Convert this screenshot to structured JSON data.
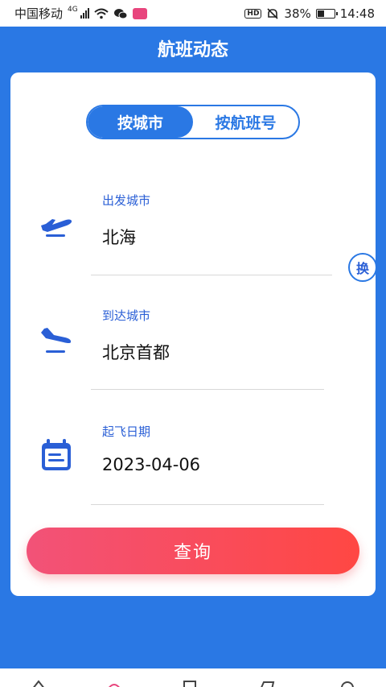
{
  "status": {
    "carrier": "中国移动",
    "signal_tag": "4G",
    "battery": "38%",
    "time": "14:48",
    "hd": "HD"
  },
  "header": {
    "title": "航班动态"
  },
  "toggle": {
    "by_city": "按城市",
    "by_flight": "按航班号"
  },
  "form": {
    "departure": {
      "label": "出发城市",
      "value": "北海"
    },
    "arrival": {
      "label": "到达城市",
      "value": "北京首都"
    },
    "date": {
      "label": "起飞日期",
      "value": "2023-04-06"
    },
    "swap_label": "换"
  },
  "query_label": "查询",
  "colors": {
    "primary": "#2a78e4",
    "accent_start": "#f25278",
    "accent_end": "#ff4743"
  },
  "icons": [
    "plane-takeoff-icon",
    "plane-landing-icon",
    "calendar-icon",
    "swap-icon"
  ]
}
